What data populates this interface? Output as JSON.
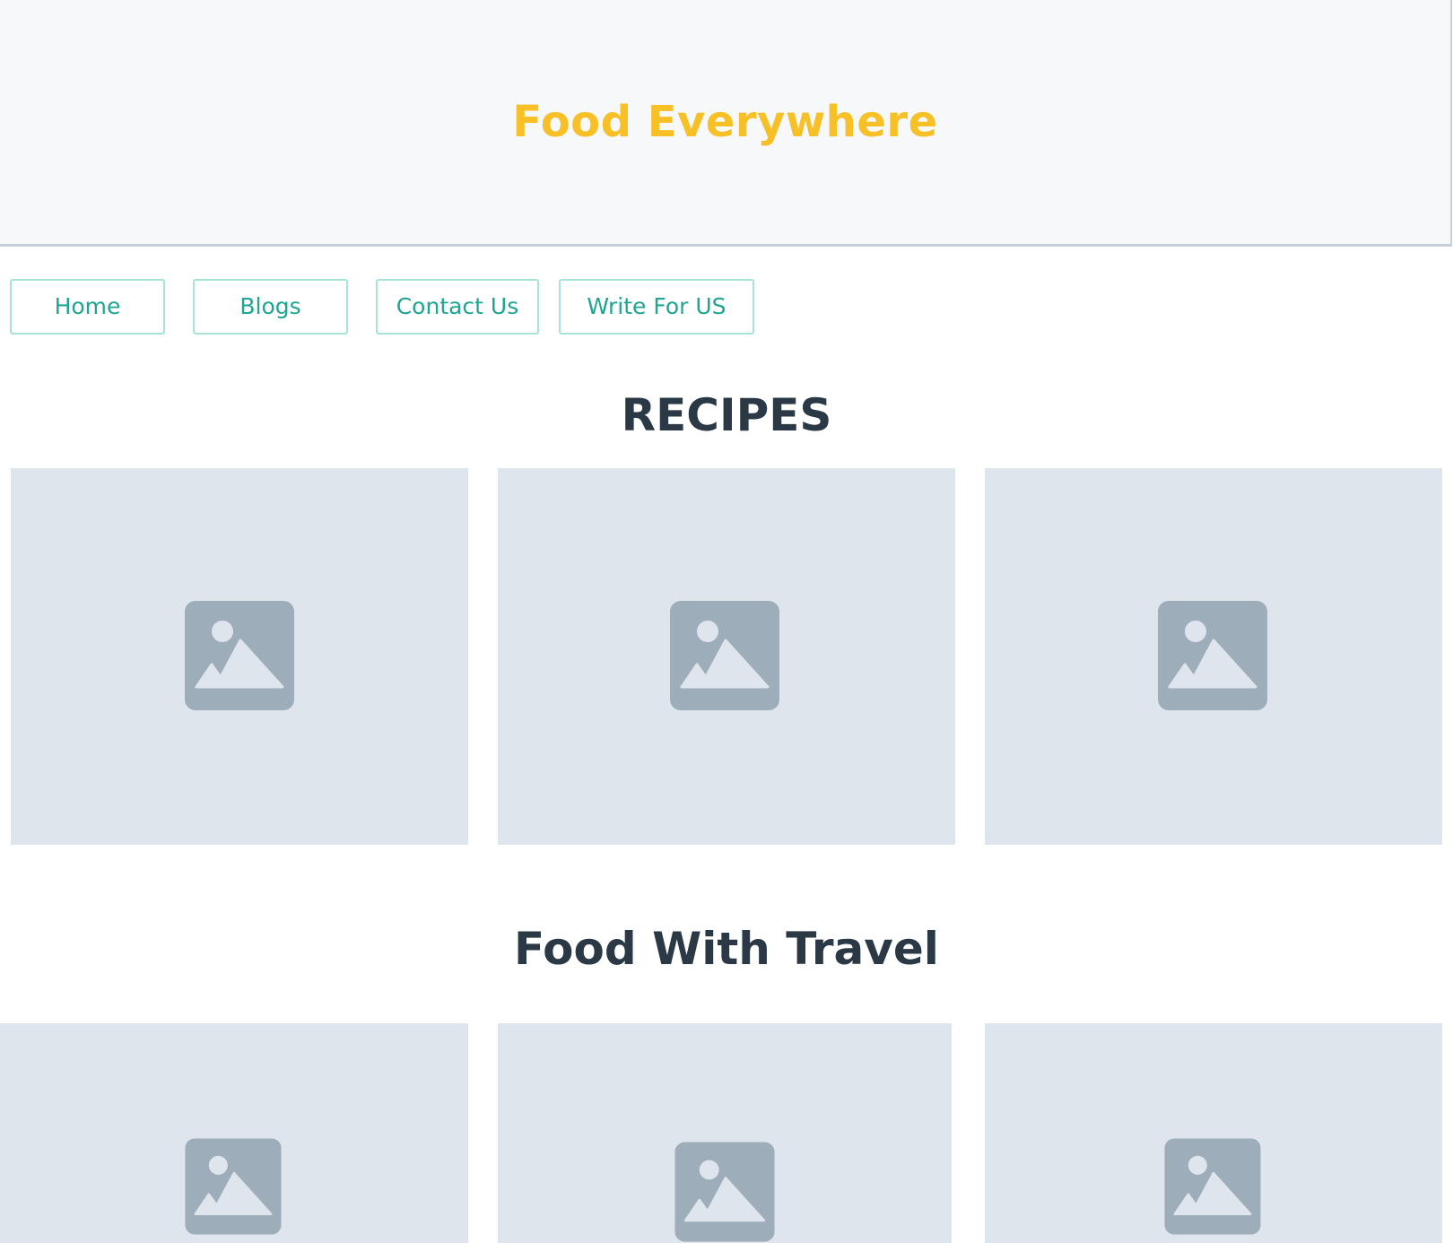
{
  "header": {
    "title": "Food Everywhere",
    "title_color": "#f6c026"
  },
  "nav": {
    "items": [
      {
        "label": "Home"
      },
      {
        "label": "Blogs"
      },
      {
        "label": "Contact Us"
      },
      {
        "label": "Write For US"
      }
    ],
    "accent_color": "#20a592"
  },
  "sections": [
    {
      "title": "RECIPES",
      "cards": [
        {
          "icon": "image-placeholder-icon"
        },
        {
          "icon": "image-placeholder-icon"
        },
        {
          "icon": "image-placeholder-icon"
        }
      ]
    },
    {
      "title": "Food With Travel",
      "cards": [
        {
          "icon": "image-placeholder-icon"
        },
        {
          "icon": "image-placeholder-icon"
        },
        {
          "icon": "image-placeholder-icon"
        }
      ]
    }
  ],
  "colors": {
    "card_background": "#dfe5ed",
    "icon_color": "#9eadba",
    "heading_color": "#2b3845"
  }
}
